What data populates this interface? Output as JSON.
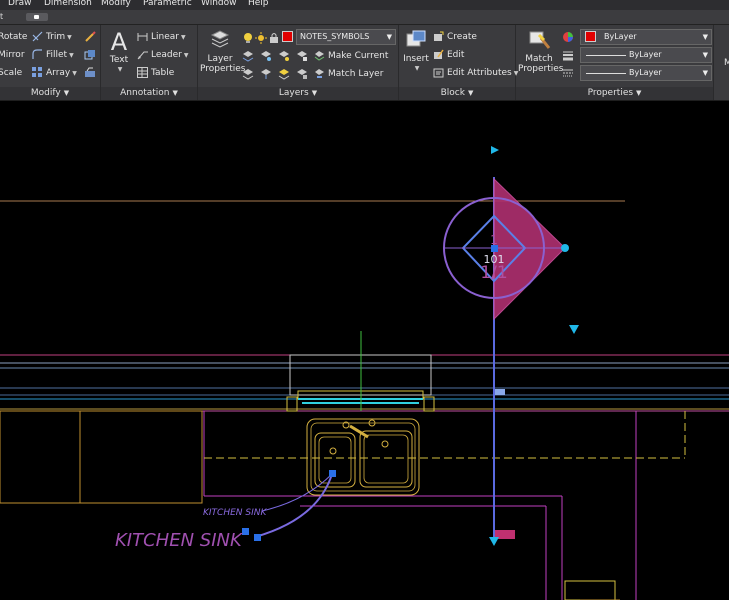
{
  "menubar": {
    "items": [
      "Draw",
      "Dimension",
      "Modify",
      "Parametric",
      "Window",
      "Help"
    ]
  },
  "tabstrip": {
    "partial_label": "t"
  },
  "ribbon": {
    "modify": {
      "title": "Modify",
      "rotate": "Rotate",
      "trim": "Trim",
      "mirror": "Mirror",
      "fillet": "Fillet",
      "scale": "Scale",
      "array": "Array"
    },
    "annotation": {
      "title": "Annotation",
      "text": "Text",
      "linear": "Linear",
      "leader": "Leader",
      "table": "Table"
    },
    "layers": {
      "title": "Layers",
      "layer_properties": "Layer Properties",
      "current_layer": "NOTES_SYMBOLS",
      "make_current": "Make Current",
      "match_layer": "Match Layer"
    },
    "block": {
      "title": "Block",
      "insert": "Insert",
      "create": "Create",
      "edit": "Edit",
      "edit_attributes": "Edit Attributes"
    },
    "properties": {
      "title": "Properties",
      "match_properties": "Match Properties",
      "color": "ByLayer",
      "linetype": "ByLayer",
      "lineweight": "ByLayer"
    },
    "next_partial": "M"
  },
  "drawing": {
    "callout_number": "101",
    "callout_top": "1",
    "callout_bottom": "1/1",
    "label_small": "KITCHEN SINK",
    "label_large": "KITCHEN SINK"
  },
  "colors": {
    "background": "#000000",
    "ribbon": "#3b3b3e",
    "magenta": "#c05090",
    "selection": "#6a7ae8",
    "cyan": "#20b8e8",
    "yellow_lines": "#b8a040"
  }
}
